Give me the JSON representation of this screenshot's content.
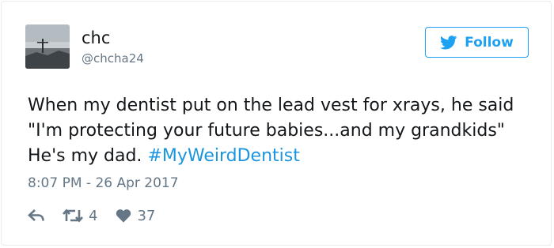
{
  "author": {
    "display_name": "chc",
    "handle": "@chcha24",
    "avatar_icon": "landscape-photo-avatar"
  },
  "follow_button": {
    "label": "Follow",
    "icon": "twitter-bird-icon",
    "color": "#1da1f2"
  },
  "tweet": {
    "text": "When my dentist put on the lead vest for xrays, he said \"I'm protecting your future babies...and my grandkids\" He's my dad.",
    "hashtag": "#MyWeirdDentist",
    "hashtag_color": "#1b95e0",
    "timestamp": "8:07 PM - 26 Apr 2017"
  },
  "actions": {
    "reply_icon": "reply-icon",
    "retweet_icon": "retweet-icon",
    "retweet_count": "4",
    "like_icon": "heart-icon",
    "like_count": "37"
  }
}
